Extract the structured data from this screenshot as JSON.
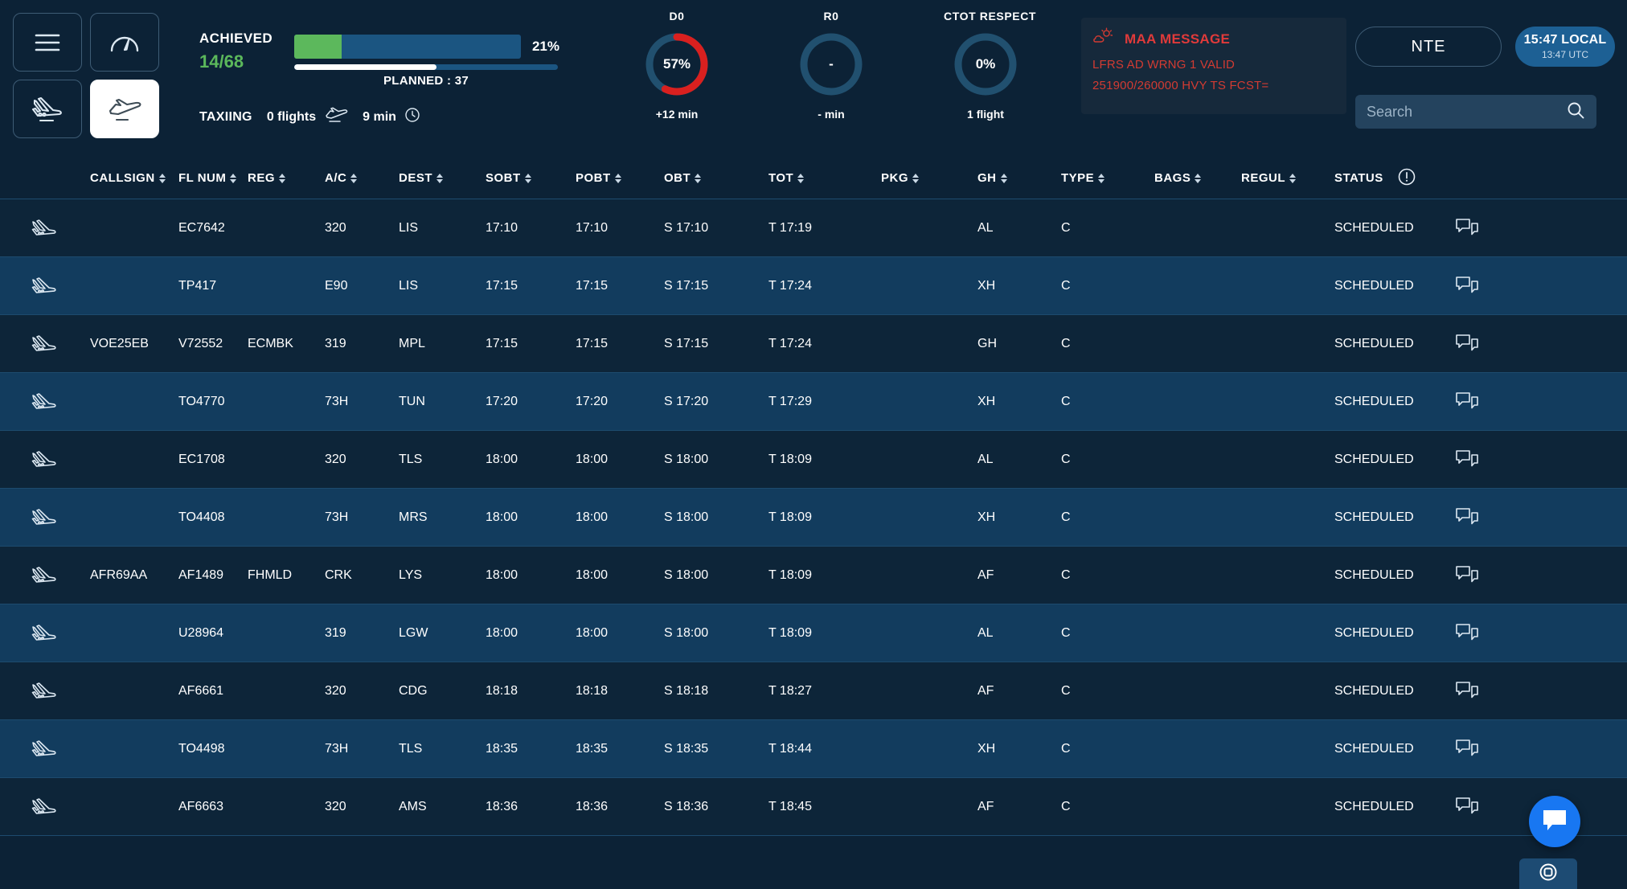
{
  "nav": {
    "buttons": [
      {
        "name": "menu-button",
        "icon": "hamburger-icon",
        "active": false
      },
      {
        "name": "dashboard-button",
        "icon": "gauge-icon",
        "active": false
      },
      {
        "name": "arrivals-button",
        "icon": "plane-landing-icon",
        "active": false
      },
      {
        "name": "departures-button",
        "icon": "plane-takeoff-icon",
        "active": true
      }
    ]
  },
  "kpi": {
    "achieved_label": "ACHIEVED",
    "achieved_value": "14/68",
    "progress_percent_label": "21%",
    "progress_percent": 21,
    "planned_label": "PLANNED : 37",
    "planned_percent": 54,
    "taxiing_label": "TAXIING",
    "taxiing_flights": "0 flights",
    "taxiing_time": "9 min"
  },
  "gauges": [
    {
      "title": "D0",
      "value": "57%",
      "percent": 57,
      "sub": "+12 min",
      "color": "#d9201f"
    },
    {
      "title": "R0",
      "value": "-",
      "percent": 0,
      "sub": "- min",
      "color": "#2a5878"
    },
    {
      "title": "CTOT RESPECT",
      "value": "0%",
      "percent": 0,
      "sub": "1 flight",
      "color": "#2a5878"
    }
  ],
  "maa": {
    "icon": "weather-cloud-sun-icon",
    "title": "MAA MESSAGE",
    "line1": "LFRS AD WRNG 1 VALID",
    "line2": "251900/260000 HVY TS FCST=",
    "color": "#d23b32"
  },
  "header": {
    "station_label": "NTE",
    "clock_local": "15:47 LOCAL",
    "clock_utc": "13:47 UTC",
    "search_placeholder": "Search",
    "search_value": ""
  },
  "table": {
    "columns": [
      {
        "key": "icon",
        "label": "",
        "sortable": false
      },
      {
        "key": "call",
        "label": "CALLSIGN",
        "sortable": true
      },
      {
        "key": "flnum",
        "label": "FL NUM",
        "sortable": true
      },
      {
        "key": "reg",
        "label": "REG",
        "sortable": true
      },
      {
        "key": "ac",
        "label": "A/C",
        "sortable": true
      },
      {
        "key": "dest",
        "label": "DEST",
        "sortable": true
      },
      {
        "key": "sobt",
        "label": "SOBT",
        "sortable": true
      },
      {
        "key": "pobt",
        "label": "POBT",
        "sortable": true
      },
      {
        "key": "obt",
        "label": "OBT",
        "sortable": true
      },
      {
        "key": "tot",
        "label": "TOT",
        "sortable": true
      },
      {
        "key": "pkg",
        "label": "PKG",
        "sortable": true
      },
      {
        "key": "gh",
        "label": "GH",
        "sortable": true
      },
      {
        "key": "type",
        "label": "TYPE",
        "sortable": true
      },
      {
        "key": "bags",
        "label": "BAGS",
        "sortable": true
      },
      {
        "key": "regul",
        "label": "REGUL",
        "sortable": true
      },
      {
        "key": "status",
        "label": "STATUS",
        "sortable": false
      }
    ],
    "status_info_icon": "info-circle-icon",
    "rows": [
      {
        "icon": "plane-takeoff-icon",
        "call": "",
        "flnum": "EC7642",
        "reg": "",
        "ac": "320",
        "dest": "LIS",
        "sobt": "17:10",
        "pobt": "17:10",
        "obt": "S 17:10",
        "tot": "T 17:19",
        "pkg": "",
        "gh": "AL",
        "type": "C",
        "bags": "",
        "regul": "",
        "status": "SCHEDULED",
        "chat": "comment-icon"
      },
      {
        "icon": "plane-takeoff-icon",
        "call": "",
        "flnum": "TP417",
        "reg": "",
        "ac": "E90",
        "dest": "LIS",
        "sobt": "17:15",
        "pobt": "17:15",
        "obt": "S 17:15",
        "tot": "T 17:24",
        "pkg": "",
        "gh": "XH",
        "type": "C",
        "bags": "",
        "regul": "",
        "status": "SCHEDULED",
        "chat": "comment-icon"
      },
      {
        "icon": "plane-takeoff-icon",
        "call": "VOE25EB",
        "flnum": "V72552",
        "reg": "ECMBK",
        "ac": "319",
        "dest": "MPL",
        "sobt": "17:15",
        "pobt": "17:15",
        "obt": "S 17:15",
        "tot": "T 17:24",
        "pkg": "",
        "gh": "GH",
        "type": "C",
        "bags": "",
        "regul": "",
        "status": "SCHEDULED",
        "chat": "comment-icon"
      },
      {
        "icon": "plane-takeoff-icon",
        "call": "",
        "flnum": "TO4770",
        "reg": "",
        "ac": "73H",
        "dest": "TUN",
        "sobt": "17:20",
        "pobt": "17:20",
        "obt": "S 17:20",
        "tot": "T 17:29",
        "pkg": "",
        "gh": "XH",
        "type": "C",
        "bags": "",
        "regul": "",
        "status": "SCHEDULED",
        "chat": "comment-icon"
      },
      {
        "icon": "plane-takeoff-icon",
        "call": "",
        "flnum": "EC1708",
        "reg": "",
        "ac": "320",
        "dest": "TLS",
        "sobt": "18:00",
        "pobt": "18:00",
        "obt": "S 18:00",
        "tot": "T 18:09",
        "pkg": "",
        "gh": "AL",
        "type": "C",
        "bags": "",
        "regul": "",
        "status": "SCHEDULED",
        "chat": "comment-icon"
      },
      {
        "icon": "plane-takeoff-icon",
        "call": "",
        "flnum": "TO4408",
        "reg": "",
        "ac": "73H",
        "dest": "MRS",
        "sobt": "18:00",
        "pobt": "18:00",
        "obt": "S 18:00",
        "tot": "T 18:09",
        "pkg": "",
        "gh": "XH",
        "type": "C",
        "bags": "",
        "regul": "",
        "status": "SCHEDULED",
        "chat": "comment-icon"
      },
      {
        "icon": "plane-takeoff-icon",
        "call": "AFR69AA",
        "flnum": "AF1489",
        "reg": "FHMLD",
        "ac": "CRK",
        "dest": "LYS",
        "sobt": "18:00",
        "pobt": "18:00",
        "obt": "S 18:00",
        "tot": "T 18:09",
        "pkg": "",
        "gh": "AF",
        "type": "C",
        "bags": "",
        "regul": "",
        "status": "SCHEDULED",
        "chat": "comment-icon"
      },
      {
        "icon": "plane-takeoff-icon",
        "call": "",
        "flnum": "U28964",
        "reg": "",
        "ac": "319",
        "dest": "LGW",
        "sobt": "18:00",
        "pobt": "18:00",
        "obt": "S 18:00",
        "tot": "T 18:09",
        "pkg": "",
        "gh": "AL",
        "type": "C",
        "bags": "",
        "regul": "",
        "status": "SCHEDULED",
        "chat": "comment-icon"
      },
      {
        "icon": "plane-takeoff-icon",
        "call": "",
        "flnum": "AF6661",
        "reg": "",
        "ac": "320",
        "dest": "CDG",
        "sobt": "18:18",
        "pobt": "18:18",
        "obt": "S 18:18",
        "tot": "T 18:27",
        "pkg": "",
        "gh": "AF",
        "type": "C",
        "bags": "",
        "regul": "",
        "status": "SCHEDULED",
        "chat": "comment-icon"
      },
      {
        "icon": "plane-takeoff-icon",
        "call": "",
        "flnum": "TO4498",
        "reg": "",
        "ac": "73H",
        "dest": "TLS",
        "sobt": "18:35",
        "pobt": "18:35",
        "obt": "S 18:35",
        "tot": "T 18:44",
        "pkg": "",
        "gh": "XH",
        "type": "C",
        "bags": "",
        "regul": "",
        "status": "SCHEDULED",
        "chat": "comment-icon"
      },
      {
        "icon": "plane-takeoff-icon",
        "call": "",
        "flnum": "AF6663",
        "reg": "",
        "ac": "320",
        "dest": "AMS",
        "sobt": "18:36",
        "pobt": "18:36",
        "obt": "S 18:36",
        "tot": "T 18:45",
        "pkg": "",
        "gh": "AF",
        "type": "C",
        "bags": "",
        "regul": "",
        "status": "SCHEDULED",
        "chat": "comment-icon"
      }
    ]
  },
  "floating": {
    "chat_fab_icon": "chat-bubble-icon",
    "support_icon": "lifebuoy-icon"
  },
  "colors": {
    "background": "#0c2236",
    "row_even": "#0d2539",
    "row_odd": "#123c5e",
    "accent_green": "#5cb85c",
    "accent_blue": "#1d6094",
    "alert_red": "#d23b32",
    "fab_blue": "#1877f2"
  }
}
